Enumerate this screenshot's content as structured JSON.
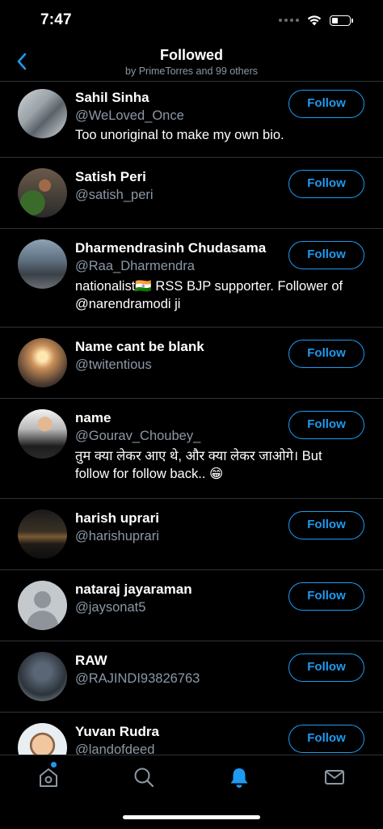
{
  "status_bar": {
    "time": "7:47"
  },
  "header": {
    "title": "Followed",
    "subtitle": "by PrimeTorres and 99 others"
  },
  "users": [
    {
      "name": "Sahil Sinha",
      "handle": "@WeLoved_Once",
      "bio": "Too unoriginal to make my own bio.",
      "button": "Follow"
    },
    {
      "name": "Satish Peri",
      "handle": "@satish_peri",
      "bio": "",
      "button": "Follow"
    },
    {
      "name": "Dharmendrasinh Chudasama",
      "handle": "@Raa_Dharmendra",
      "bio": "nationalist🇮🇳 RSS BJP supporter. Follower of @narendramodi ji",
      "button": "Follow"
    },
    {
      "name": "Name cant be blank",
      "handle": "@twitentious",
      "bio": "",
      "button": "Follow"
    },
    {
      "name": "name",
      "handle": "@Gourav_Choubey_",
      "bio": "तुम क्या लेकर आए थे, और क्या लेकर जाओगे। But follow for follow back.. 😁",
      "button": "Follow"
    },
    {
      "name": "harish uprari",
      "handle": "@harishuprari",
      "bio": "",
      "button": "Follow"
    },
    {
      "name": "nataraj jayaraman",
      "handle": "@jaysonat5",
      "bio": "",
      "button": "Follow"
    },
    {
      "name": "RAW",
      "handle": "@RAJINDI93826763",
      "bio": "",
      "button": "Follow"
    },
    {
      "name": "Yuvan Rudra",
      "handle": "@landofdeed",
      "bio": "",
      "button": "Follow"
    }
  ],
  "tabbar": {
    "icons": [
      "home-icon",
      "search-icon",
      "notifications-icon",
      "messages-icon"
    ],
    "active": "notifications-icon"
  },
  "colors": {
    "accent": "#1d9bf0",
    "background": "#000000",
    "secondary_text": "#8b98a5",
    "divider": "#2f3336"
  }
}
